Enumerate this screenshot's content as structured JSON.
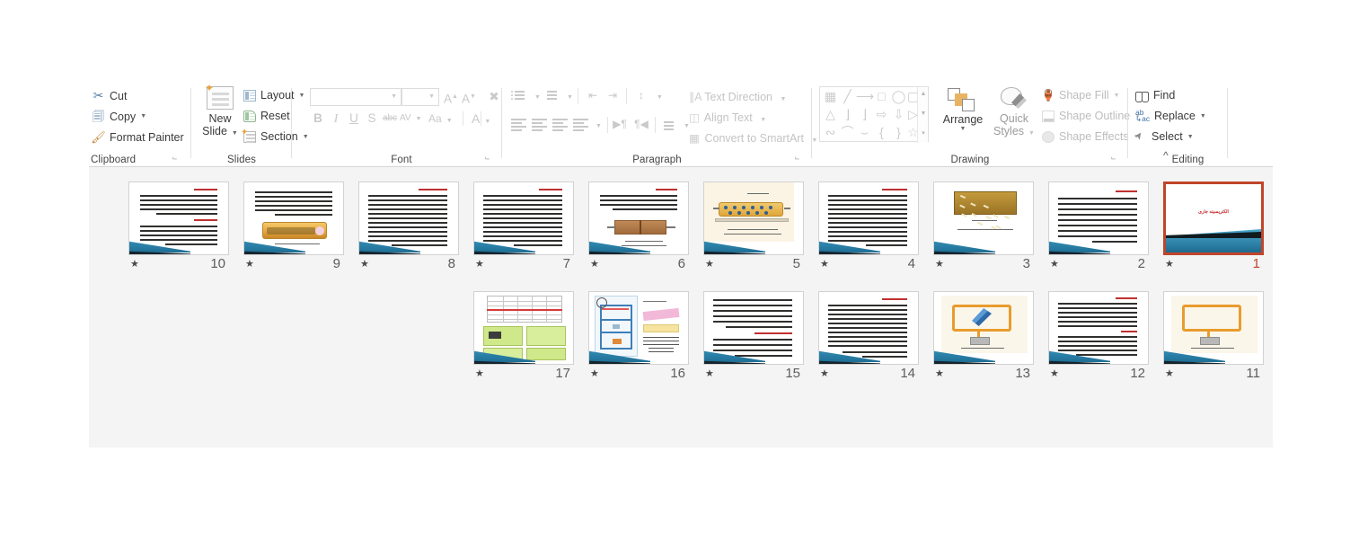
{
  "app": {
    "name": "PowerPoint",
    "view": "Slide Sorter"
  },
  "ribbon": {
    "collapse_icon": "chevron-up",
    "groups": [
      {
        "id": "clipboard",
        "label": "Clipboard"
      },
      {
        "id": "slides",
        "label": "Slides"
      },
      {
        "id": "font",
        "label": "Font"
      },
      {
        "id": "paragraph",
        "label": "Paragraph"
      },
      {
        "id": "drawing",
        "label": "Drawing"
      },
      {
        "id": "editing",
        "label": "Editing"
      }
    ],
    "clipboard": {
      "cut": "Cut",
      "copy": "Copy",
      "format_painter": "Format Painter",
      "cut_icon": "scissors-icon",
      "copy_icon": "copy-icon",
      "format_painter_icon": "paintbrush-icon"
    },
    "slides": {
      "new_slide_line1": "New",
      "new_slide_line2": "Slide",
      "layout": "Layout",
      "reset": "Reset",
      "section": "Section"
    },
    "font": {
      "font_name_value": "",
      "font_size_value": "",
      "grow_font": "A",
      "shrink_font": "A",
      "clear_formatting": "clear-formatting-icon",
      "bold": "B",
      "italic": "I",
      "underline": "U",
      "shadow": "S",
      "strikethrough": "abc",
      "character_spacing": "AV",
      "change_case": "Aa",
      "font_color": "A",
      "disabled": true
    },
    "paragraph": {
      "text_direction": "Text Direction",
      "align_text": "Align Text",
      "convert_to_smartart": "Convert to SmartArt",
      "bullets_icon": "bullets-icon",
      "numbering_icon": "numbering-icon",
      "decrease_indent_icon": "decrease-indent-icon",
      "increase_indent_icon": "increase-indent-icon",
      "line_spacing_icon": "line-spacing-icon",
      "align_left_icon": "align-left-icon",
      "align_center_icon": "align-center-icon",
      "align_right_icon": "align-right-icon",
      "justify_icon": "justify-icon",
      "ltr_icon": "left-to-right-icon",
      "rtl_icon": "right-to-left-icon",
      "columns_icon": "columns-icon",
      "disabled": true
    },
    "drawing": {
      "arrange": "Arrange",
      "quick_styles_line1": "Quick",
      "quick_styles_line2": "Styles",
      "shape_fill": "Shape Fill",
      "shape_outline": "Shape Outline",
      "shape_effects": "Shape Effects",
      "shapes": [
        "textbox-shape",
        "line-shape",
        "arrow-shape",
        "rectangle-shape",
        "oval-shape",
        "rounded-rectangle-shape",
        "triangle-shape",
        "elbow-connector-shape",
        "elbow-arrow-shape",
        "right-arrow-shape",
        "down-arrow-shape",
        "folded-corner-shape",
        "freeform-shape",
        "curve-shape",
        "arc-shape",
        "left-brace-shape",
        "right-brace-shape",
        "star-shape"
      ]
    },
    "editing": {
      "find": "Find",
      "replace": "Replace",
      "select": "Select",
      "find_icon": "binoculars-icon",
      "replace_icon": "ab-ac-icon",
      "select_icon": "cursor-arrow-icon"
    }
  },
  "sorter": {
    "selected_slide": 1,
    "transition_star": "★",
    "slides": [
      {
        "num": "10",
        "type": "text",
        "headings": 2,
        "lines": 11,
        "selected": false
      },
      {
        "num": "9",
        "type": "text-image",
        "image": "yellow-rod-diagram",
        "lines": 7,
        "selected": false
      },
      {
        "num": "8",
        "type": "text",
        "headings": 1,
        "lines": 13,
        "selected": false
      },
      {
        "num": "7",
        "type": "text",
        "headings": 1,
        "lines": 12,
        "selected": false
      },
      {
        "num": "6",
        "type": "text-image",
        "image": "brown-resistor-diagram",
        "lines": 5,
        "selected": false
      },
      {
        "num": "5",
        "type": "image",
        "image": "conductor-electrons-diagram",
        "selected": false
      },
      {
        "num": "4",
        "type": "text",
        "headings": 1,
        "lines": 12,
        "selected": false
      },
      {
        "num": "3",
        "type": "image",
        "image": "golden-particles-photo",
        "selected": false
      },
      {
        "num": "2",
        "type": "text",
        "headings": 1,
        "lines": 10,
        "selected": false
      },
      {
        "num": "1",
        "type": "title",
        "title_text": "الکتریسیته جاری",
        "selected": true
      },
      {
        "num": "17",
        "type": "image",
        "image": "table-green-boxes",
        "selected": false
      },
      {
        "num": "16",
        "type": "image",
        "image": "blue-circuit-pink-boxes",
        "selected": false
      },
      {
        "num": "15",
        "type": "text",
        "headings": 1,
        "lines": 12,
        "selected": false
      },
      {
        "num": "14",
        "type": "text",
        "headings": 1,
        "lines": 13,
        "selected": false
      },
      {
        "num": "13",
        "type": "image",
        "image": "orange-circuit-blue-arrow",
        "selected": false
      },
      {
        "num": "12",
        "type": "text",
        "headings": 2,
        "lines": 12,
        "selected": false
      },
      {
        "num": "11",
        "type": "image",
        "image": "orange-circuit-loop",
        "selected": false
      }
    ]
  },
  "colors": {
    "selection": "#c0452a",
    "workspace_bg": "#f4f4f4",
    "ribbon_bg": "#ffffff",
    "disabled_text": "#c4c4c4",
    "slide_accent_teal": "#2b86ad",
    "slide_heading_red": "#c42121"
  }
}
